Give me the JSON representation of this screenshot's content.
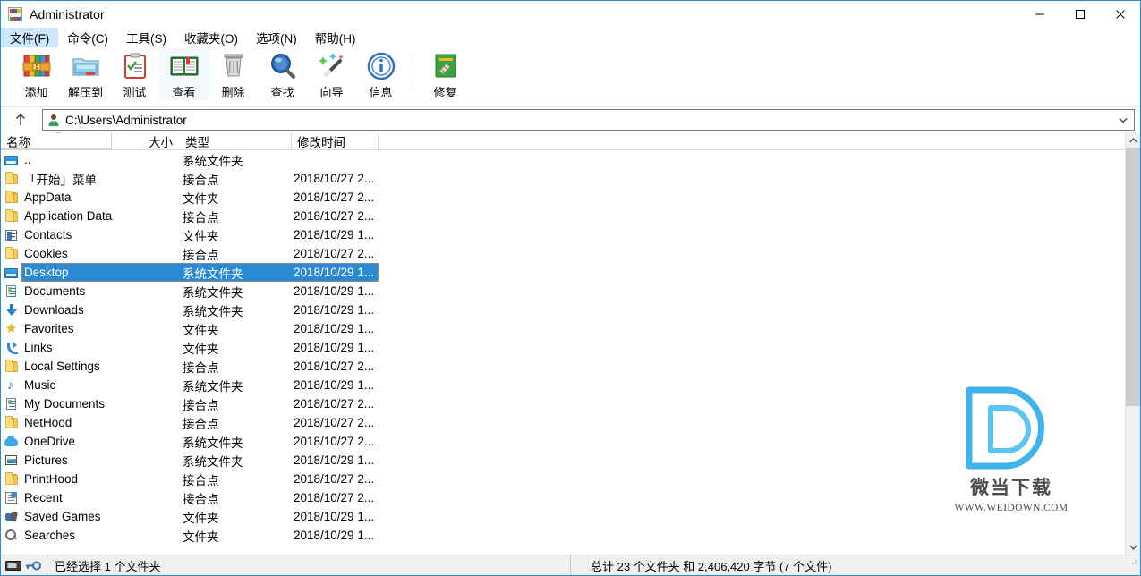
{
  "window": {
    "title": "Administrator",
    "app_icon": "winrar-books-icon",
    "controls": {
      "minimize": "minimize-icon",
      "maximize": "maximize-icon",
      "close": "close-icon"
    }
  },
  "menubar": {
    "items": [
      {
        "label": "文件(F)",
        "active": true
      },
      {
        "label": "命令(C)",
        "active": false
      },
      {
        "label": "工具(S)",
        "active": false
      },
      {
        "label": "收藏夹(O)",
        "active": false
      },
      {
        "label": "选项(N)",
        "active": false
      },
      {
        "label": "帮助(H)",
        "active": false
      }
    ]
  },
  "toolbar": {
    "buttons": [
      {
        "label": "添加",
        "icon": "add-archive-icon",
        "highlighted": false
      },
      {
        "label": "解压到",
        "icon": "extract-to-folder-icon",
        "highlighted": false
      },
      {
        "label": "测试",
        "icon": "test-clipboard-icon",
        "highlighted": false
      },
      {
        "label": "查看",
        "icon": "view-book-icon",
        "highlighted": true
      },
      {
        "label": "删除",
        "icon": "delete-trash-icon",
        "highlighted": false
      },
      {
        "label": "查找",
        "icon": "find-magnifier-icon",
        "highlighted": false
      },
      {
        "label": "向导",
        "icon": "wizard-wand-icon",
        "highlighted": false
      },
      {
        "label": "信息",
        "icon": "info-circle-icon",
        "highlighted": false
      }
    ],
    "separator_after": 8,
    "extra_buttons": [
      {
        "label": "修复",
        "icon": "repair-icon",
        "highlighted": false
      }
    ]
  },
  "addressbar": {
    "up_icon": "arrow-up-icon",
    "path_icon": "user-account-icon",
    "path": "C:\\Users\\Administrator",
    "dropdown_icon": "chevron-down-icon"
  },
  "filelist": {
    "columns": [
      {
        "key": "name",
        "label": "名称",
        "sorted": true,
        "sort_dir": "asc"
      },
      {
        "key": "size",
        "label": "大小"
      },
      {
        "key": "type",
        "label": "类型"
      },
      {
        "key": "time",
        "label": "修改时间"
      }
    ],
    "rows": [
      {
        "name": "..",
        "icon": "parent-folder-icon",
        "size": "",
        "type": "系统文件夹",
        "time": "",
        "selected": false
      },
      {
        "name": "「开始」菜单",
        "icon": "folder-junction-icon",
        "size": "",
        "type": "接合点",
        "time": "2018/10/27 2...",
        "selected": false
      },
      {
        "name": "AppData",
        "icon": "folder-icon",
        "size": "",
        "type": "文件夹",
        "time": "2018/10/27 2...",
        "selected": false
      },
      {
        "name": "Application Data",
        "icon": "folder-junction-icon",
        "size": "",
        "type": "接合点",
        "time": "2018/10/27 2...",
        "selected": false
      },
      {
        "name": "Contacts",
        "icon": "contacts-icon",
        "size": "",
        "type": "文件夹",
        "time": "2018/10/29 1...",
        "selected": false
      },
      {
        "name": "Cookies",
        "icon": "folder-junction-icon",
        "size": "",
        "type": "接合点",
        "time": "2018/10/27 2...",
        "selected": false
      },
      {
        "name": "Desktop",
        "icon": "desktop-folder-icon",
        "size": "",
        "type": "系统文件夹",
        "time": "2018/10/29 1...",
        "selected": true
      },
      {
        "name": "Documents",
        "icon": "documents-icon",
        "size": "",
        "type": "系统文件夹",
        "time": "2018/10/29 1...",
        "selected": false
      },
      {
        "name": "Downloads",
        "icon": "downloads-icon",
        "size": "",
        "type": "系统文件夹",
        "time": "2018/10/29 1...",
        "selected": false
      },
      {
        "name": "Favorites",
        "icon": "favorites-star-icon",
        "size": "",
        "type": "文件夹",
        "time": "2018/10/29 1...",
        "selected": false
      },
      {
        "name": "Links",
        "icon": "links-arrow-icon",
        "size": "",
        "type": "文件夹",
        "time": "2018/10/29 1...",
        "selected": false
      },
      {
        "name": "Local Settings",
        "icon": "folder-junction-icon",
        "size": "",
        "type": "接合点",
        "time": "2018/10/27 2...",
        "selected": false
      },
      {
        "name": "Music",
        "icon": "music-note-icon",
        "size": "",
        "type": "系统文件夹",
        "time": "2018/10/29 1...",
        "selected": false
      },
      {
        "name": "My Documents",
        "icon": "documents-icon",
        "size": "",
        "type": "接合点",
        "time": "2018/10/27 2...",
        "selected": false
      },
      {
        "name": "NetHood",
        "icon": "folder-junction-icon",
        "size": "",
        "type": "接合点",
        "time": "2018/10/27 2...",
        "selected": false
      },
      {
        "name": "OneDrive",
        "icon": "onedrive-cloud-icon",
        "size": "",
        "type": "系统文件夹",
        "time": "2018/10/27 2...",
        "selected": false
      },
      {
        "name": "Pictures",
        "icon": "pictures-icon",
        "size": "",
        "type": "系统文件夹",
        "time": "2018/10/29 1...",
        "selected": false
      },
      {
        "name": "PrintHood",
        "icon": "folder-junction-icon",
        "size": "",
        "type": "接合点",
        "time": "2018/10/27 2...",
        "selected": false
      },
      {
        "name": "Recent",
        "icon": "recent-icon",
        "size": "",
        "type": "接合点",
        "time": "2018/10/27 2...",
        "selected": false
      },
      {
        "name": "Saved Games",
        "icon": "saved-games-icon",
        "size": "",
        "type": "文件夹",
        "time": "2018/10/29 1...",
        "selected": false
      },
      {
        "name": "Searches",
        "icon": "searches-icon",
        "size": "",
        "type": "文件夹",
        "time": "2018/10/29 1...",
        "selected": false
      }
    ]
  },
  "scrollbar": {
    "up_icon": "scroll-up-icon",
    "down_icon": "scroll-down-icon",
    "thumb_top_pct": 0,
    "thumb_height_pct": 66
  },
  "statusbar": {
    "left_icons": [
      "drive-icon",
      "key-icon"
    ],
    "left_text": "已经选择 1 个文件夹",
    "right_text": "总计 23 个文件夹 和 2,406,420 字节 (7 个文件)"
  },
  "watermark": {
    "cn": "微当下载",
    "url": "WWW.WEIDOWN.COM",
    "logo_color": "#3fb3ec"
  },
  "colors": {
    "selection": "#2a8ad4",
    "menu_active": "#cce8ff",
    "window_border": "#2a8ad4",
    "statusbar_bg": "#f0f0f0"
  }
}
